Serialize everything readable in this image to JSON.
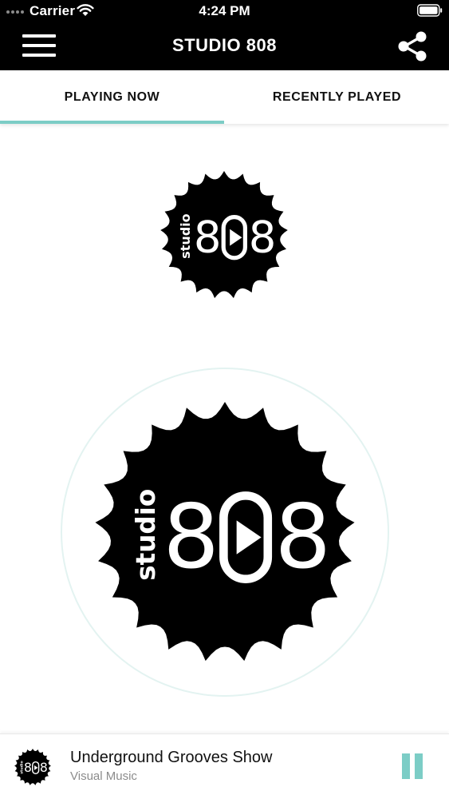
{
  "status_bar": {
    "carrier": "Carrier",
    "time": "4:24 PM",
    "icons": [
      "signal-dots-icon",
      "wifi-icon",
      "battery-icon"
    ]
  },
  "nav": {
    "title": "STUDIO 808",
    "menu_icon": "hamburger-menu-icon",
    "share_icon": "share-icon"
  },
  "tabs": [
    {
      "label": "PLAYING NOW",
      "active": true
    },
    {
      "label": "RECENTLY PLAYED",
      "active": false
    }
  ],
  "logo": {
    "word": "studio",
    "number_left": "8",
    "number_right": "8"
  },
  "now_playing": {
    "title": "Underground Grooves Show",
    "subtitle": "Visual Music",
    "control_icon": "pause-icon"
  },
  "colors": {
    "bar_background": "#000000",
    "accent": "#7ccdc6",
    "ring": "#e3f3f1"
  }
}
